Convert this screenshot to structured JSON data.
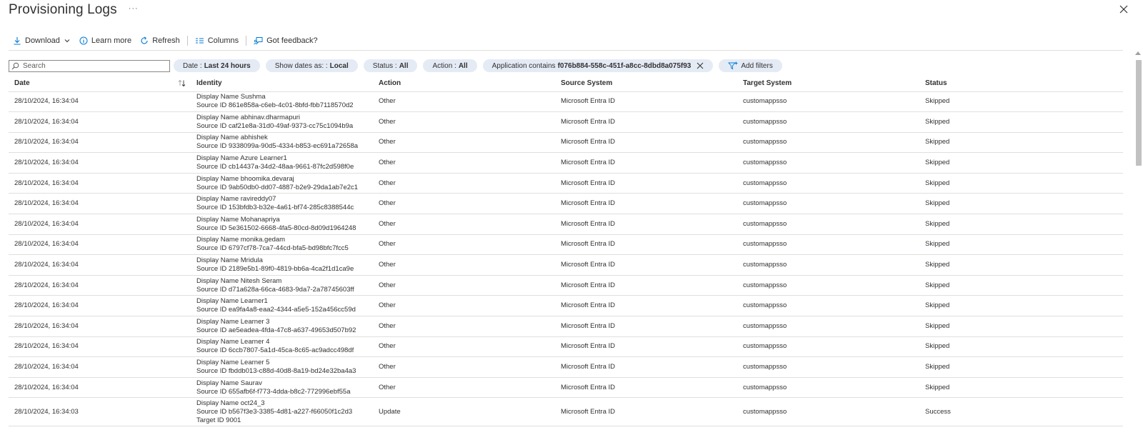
{
  "page": {
    "title": "Provisioning Logs",
    "more": "···"
  },
  "toolbar": {
    "download": "Download",
    "learn_more": "Learn more",
    "refresh": "Refresh",
    "columns": "Columns",
    "feedback": "Got feedback?"
  },
  "filters": {
    "search_placeholder": "Search",
    "date_label": "Date :",
    "date_value": "Last 24 hours",
    "show_dates_label": "Show dates as: :",
    "show_dates_value": "Local",
    "status_label": "Status :",
    "status_value": "All",
    "action_label": "Action :",
    "action_value": "All",
    "app_label": "Application contains",
    "app_value": "f076b884-558c-451f-a8cc-8dbd8a075f93",
    "add_filters": "Add filters"
  },
  "table": {
    "columns": [
      "Date",
      "Identity",
      "Action",
      "Source System",
      "Target System",
      "Status"
    ],
    "rows": [
      {
        "date": "28/10/2024, 16:34:04",
        "name": "Display Name Sushma",
        "source": "Source ID 861e858a-c6eb-4c01-8bfd-fbb7118570d2",
        "target": "",
        "action": "Other",
        "src_sys": "Microsoft Entra ID",
        "tgt_sys": "customappsso",
        "status": "Skipped"
      },
      {
        "date": "28/10/2024, 16:34:04",
        "name": "Display Name abhinav.dharmapuri",
        "source": "Source ID caf21e8a-31d0-49af-9373-cc75c1094b9a",
        "target": "",
        "action": "Other",
        "src_sys": "Microsoft Entra ID",
        "tgt_sys": "customappsso",
        "status": "Skipped"
      },
      {
        "date": "28/10/2024, 16:34:04",
        "name": "Display Name abhishek",
        "source": "Source ID 9338099a-90d5-4334-b853-ec691a72658a",
        "target": "",
        "action": "Other",
        "src_sys": "Microsoft Entra ID",
        "tgt_sys": "customappsso",
        "status": "Skipped"
      },
      {
        "date": "28/10/2024, 16:34:04",
        "name": "Display Name Azure Learner1",
        "source": "Source ID cb14437a-34d2-48aa-9661-87fc2d598f0e",
        "target": "",
        "action": "Other",
        "src_sys": "Microsoft Entra ID",
        "tgt_sys": "customappsso",
        "status": "Skipped"
      },
      {
        "date": "28/10/2024, 16:34:04",
        "name": "Display Name bhoomika.devaraj",
        "source": "Source ID 9ab50db0-dd07-4887-b2e9-29da1ab7e2c1",
        "target": "",
        "action": "Other",
        "src_sys": "Microsoft Entra ID",
        "tgt_sys": "customappsso",
        "status": "Skipped"
      },
      {
        "date": "28/10/2024, 16:34:04",
        "name": "Display Name ravireddy07",
        "source": "Source ID 153bfdb3-b32e-4a61-bf74-285c8388544c",
        "target": "",
        "action": "Other",
        "src_sys": "Microsoft Entra ID",
        "tgt_sys": "customappsso",
        "status": "Skipped"
      },
      {
        "date": "28/10/2024, 16:34:04",
        "name": "Display Name Mohanapriya",
        "source": "Source ID 5e361502-6668-4fa5-80cd-8d09d1964248",
        "target": "",
        "action": "Other",
        "src_sys": "Microsoft Entra ID",
        "tgt_sys": "customappsso",
        "status": "Skipped"
      },
      {
        "date": "28/10/2024, 16:34:04",
        "name": "Display Name monika.gedam",
        "source": "Source ID 6797cf78-7ca7-44cd-bfa5-bd98bfc7fcc5",
        "target": "",
        "action": "Other",
        "src_sys": "Microsoft Entra ID",
        "tgt_sys": "customappsso",
        "status": "Skipped"
      },
      {
        "date": "28/10/2024, 16:34:04",
        "name": "Display Name Mridula",
        "source": "Source ID 2189e5b1-89f0-4819-bb6a-4ca2f1d1ca9e",
        "target": "",
        "action": "Other",
        "src_sys": "Microsoft Entra ID",
        "tgt_sys": "customappsso",
        "status": "Skipped"
      },
      {
        "date": "28/10/2024, 16:34:04",
        "name": "Display Name Nitesh Seram",
        "source": "Source ID d71a628a-66ca-4683-9da7-2a78745603ff",
        "target": "",
        "action": "Other",
        "src_sys": "Microsoft Entra ID",
        "tgt_sys": "customappsso",
        "status": "Skipped"
      },
      {
        "date": "28/10/2024, 16:34:04",
        "name": "Display Name Learner1",
        "source": "Source ID ea9fa4a8-eaa2-4344-a5e5-152a456cc59d",
        "target": "",
        "action": "Other",
        "src_sys": "Microsoft Entra ID",
        "tgt_sys": "customappsso",
        "status": "Skipped"
      },
      {
        "date": "28/10/2024, 16:34:04",
        "name": "Display Name Learner 3",
        "source": "Source ID ae5eadea-4fda-47c8-a637-49653d507b92",
        "target": "",
        "action": "Other",
        "src_sys": "Microsoft Entra ID",
        "tgt_sys": "customappsso",
        "status": "Skipped"
      },
      {
        "date": "28/10/2024, 16:34:04",
        "name": "Display Name Learner 4",
        "source": "Source ID 6ccb7807-5a1d-45ca-8c65-ac9adcc498df",
        "target": "",
        "action": "Other",
        "src_sys": "Microsoft Entra ID",
        "tgt_sys": "customappsso",
        "status": "Skipped"
      },
      {
        "date": "28/10/2024, 16:34:04",
        "name": "Display Name Learner 5",
        "source": "Source ID fbddb013-c88d-40d8-8a19-bd24e32ba4a3",
        "target": "",
        "action": "Other",
        "src_sys": "Microsoft Entra ID",
        "tgt_sys": "customappsso",
        "status": "Skipped"
      },
      {
        "date": "28/10/2024, 16:34:04",
        "name": "Display Name Saurav",
        "source": "Source ID 655afb6f-f773-4dda-b8c2-772996ebf55a",
        "target": "",
        "action": "Other",
        "src_sys": "Microsoft Entra ID",
        "tgt_sys": "customappsso",
        "status": "Skipped"
      },
      {
        "date": "28/10/2024, 16:34:03",
        "name": "Display Name oct24_3",
        "source": "Source ID b567f3e3-3385-4d81-a227-f66050f1c2d3",
        "target": "Target ID 9001",
        "action": "Update",
        "src_sys": "Microsoft Entra ID",
        "tgt_sys": "customappsso",
        "status": "Success"
      }
    ]
  },
  "colors": {
    "accent": "#0078d4",
    "pill_bg": "#e4ebf5",
    "border": "#e1dfdd"
  }
}
